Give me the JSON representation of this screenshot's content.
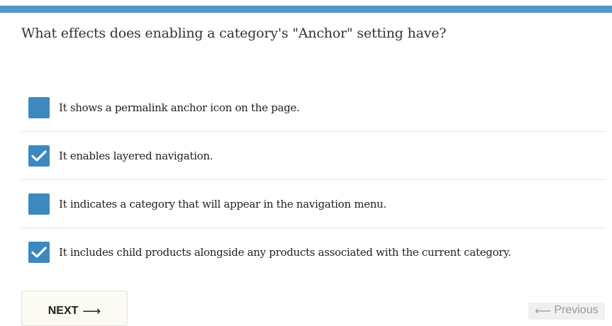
{
  "question": {
    "text": "What effects does enabling a category's \"Anchor\" setting have?"
  },
  "options": [
    {
      "label": "It shows a permalink anchor icon on the page.",
      "checked": false
    },
    {
      "label": "It enables layered navigation.",
      "checked": true
    },
    {
      "label": "It indicates a category that will appear in the navigation menu.",
      "checked": false
    },
    {
      "label": "It includes child products alongside any products associated with the current category.",
      "checked": true
    }
  ],
  "navigation": {
    "next_label": "NEXT",
    "next_arrow": "⟶",
    "previous_label": "Previous",
    "previous_arrow": "⟵"
  },
  "colors": {
    "accent_bar": "#5197c7",
    "checkbox": "#3d88bf"
  }
}
